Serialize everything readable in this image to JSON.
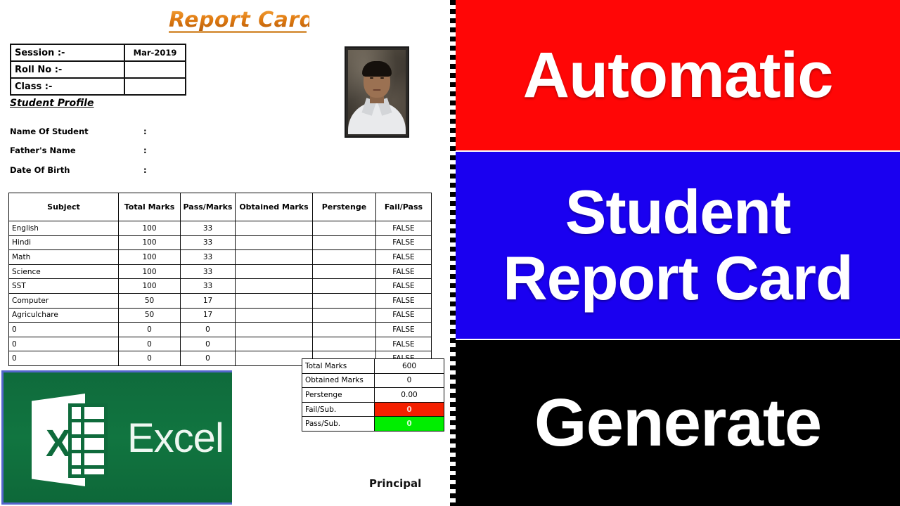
{
  "report": {
    "title": "Report Card",
    "session_table": [
      {
        "label": "Session :-",
        "value": "Mar-2019"
      },
      {
        "label": "Roll No :-",
        "value": ""
      },
      {
        "label": "Class :-",
        "value": ""
      }
    ],
    "profile_heading": "Student Profile",
    "profile_rows": [
      {
        "label": "Name Of Student",
        "colon": ":",
        "value": ""
      },
      {
        "label": "Father's Name",
        "colon": ":",
        "value": ""
      },
      {
        "label": "Date Of Birth",
        "colon": ":",
        "value": ""
      }
    ],
    "marks_headers": [
      "Subject",
      "Total Marks",
      "Pass/Marks",
      "Obtained Marks",
      "Perstenge",
      "Fail/Pass"
    ],
    "marks_rows": [
      {
        "subject": "English",
        "total": "100",
        "pass": "33",
        "obtained": "",
        "percent": "",
        "result": "FALSE"
      },
      {
        "subject": "Hindi",
        "total": "100",
        "pass": "33",
        "obtained": "",
        "percent": "",
        "result": "FALSE"
      },
      {
        "subject": "Math",
        "total": "100",
        "pass": "33",
        "obtained": "",
        "percent": "",
        "result": "FALSE"
      },
      {
        "subject": "Science",
        "total": "100",
        "pass": "33",
        "obtained": "",
        "percent": "",
        "result": "FALSE"
      },
      {
        "subject": "SST",
        "total": "100",
        "pass": "33",
        "obtained": "",
        "percent": "",
        "result": "FALSE"
      },
      {
        "subject": "Computer",
        "total": "50",
        "pass": "17",
        "obtained": "",
        "percent": "",
        "result": "FALSE"
      },
      {
        "subject": "Agriculchare",
        "total": "50",
        "pass": "17",
        "obtained": "",
        "percent": "",
        "result": "FALSE"
      },
      {
        "subject": "0",
        "total": "0",
        "pass": "0",
        "obtained": "",
        "percent": "",
        "result": "FALSE"
      },
      {
        "subject": "0",
        "total": "0",
        "pass": "0",
        "obtained": "",
        "percent": "",
        "result": "FALSE"
      },
      {
        "subject": "0",
        "total": "0",
        "pass": "0",
        "obtained": "",
        "percent": "",
        "result": "FALSE"
      }
    ],
    "summary_rows": [
      {
        "label": "Total Marks",
        "value": "600"
      },
      {
        "label": "Obtained Marks",
        "value": "0"
      },
      {
        "label": "Perstenge",
        "value": "0.00"
      },
      {
        "label": "Fail/Sub.",
        "value": "0"
      },
      {
        "label": "Pass/Sub.",
        "value": "0"
      }
    ],
    "signature": "Principal"
  },
  "excel_logo": {
    "wordmark": "Excel",
    "letter": "X"
  },
  "thumbnail": {
    "line_red": "Automatic",
    "line_blue_1": "Student",
    "line_blue_2": "Report Card",
    "line_black": "Generate"
  },
  "colors": {
    "title_orange": "#E07B12",
    "band_red": "#FF0606",
    "band_blue": "#1A00F0",
    "band_black": "#000000",
    "excel_green": "#117540",
    "fail_red": "#F42000",
    "pass_green": "#00EE00"
  }
}
